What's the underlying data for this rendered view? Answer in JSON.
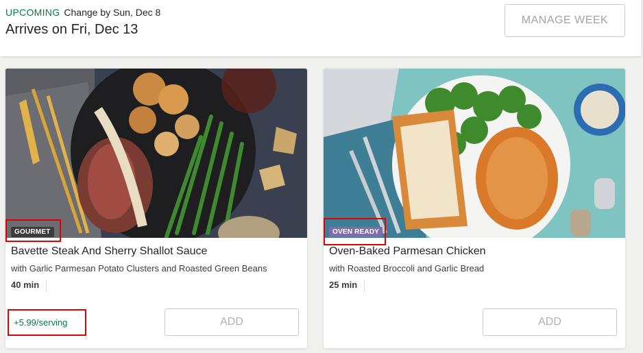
{
  "header": {
    "status": "UPCOMING",
    "change_by": "Change by Sun, Dec 8",
    "arrives": "Arrives on Fri, Dec 13",
    "manage_button": "MANAGE WEEK"
  },
  "colors": {
    "accent_green": "#067a46",
    "gourmet_badge": "#3c3c3c",
    "oven_ready_badge": "#7d6eab",
    "highlight_red": "#e00000"
  },
  "meals": [
    {
      "badge": "GOURMET",
      "title": "Bavette Steak And Sherry Shallot Sauce",
      "subtitle": "with Garlic Parmesan Potato Clusters and Roasted Green Beans",
      "time": "40 min",
      "price": "+5.99/serving",
      "add_button": "ADD",
      "image": "steak-plate-photo"
    },
    {
      "badge": "OVEN READY",
      "title": "Oven-Baked Parmesan Chicken",
      "subtitle": "with Roasted Broccoli and Garlic Bread",
      "time": "25 min",
      "price": "",
      "add_button": "ADD",
      "image": "chicken-plate-photo"
    }
  ]
}
